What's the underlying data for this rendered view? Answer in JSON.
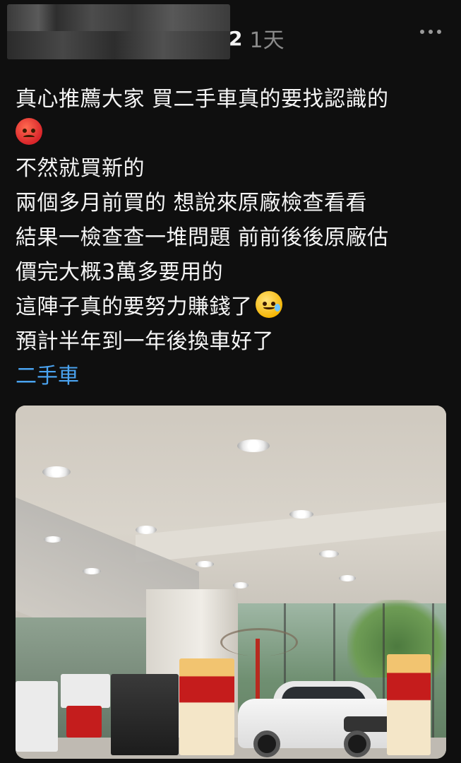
{
  "header": {
    "author_name_blurred": "",
    "reply_count": "2",
    "timestamp": "1天",
    "more_menu": "more-icon"
  },
  "post": {
    "lines": [
      "真心推薦大家 買二手車真的要找認識的",
      "不然就買新的",
      "兩個多月前買的 想說來原廠檢查看看",
      "結果一檢查查一堆問題 前前後後原廠估",
      "價完大概3萬多要用的",
      "這陣子真的要努力賺錢了",
      "預計半年到一年後換車好了"
    ],
    "emojis": [
      "angry-face-emoji",
      "smiling-face-with-tear-emoji"
    ],
    "tag": "二手車"
  },
  "photo": {
    "alt_icon": "car-dealership-showroom-photo"
  },
  "colors": {
    "background": "#0f0f0f",
    "text": "#f5f5f5",
    "muted": "#8a8a8a",
    "tag": "#4aa3f0"
  }
}
